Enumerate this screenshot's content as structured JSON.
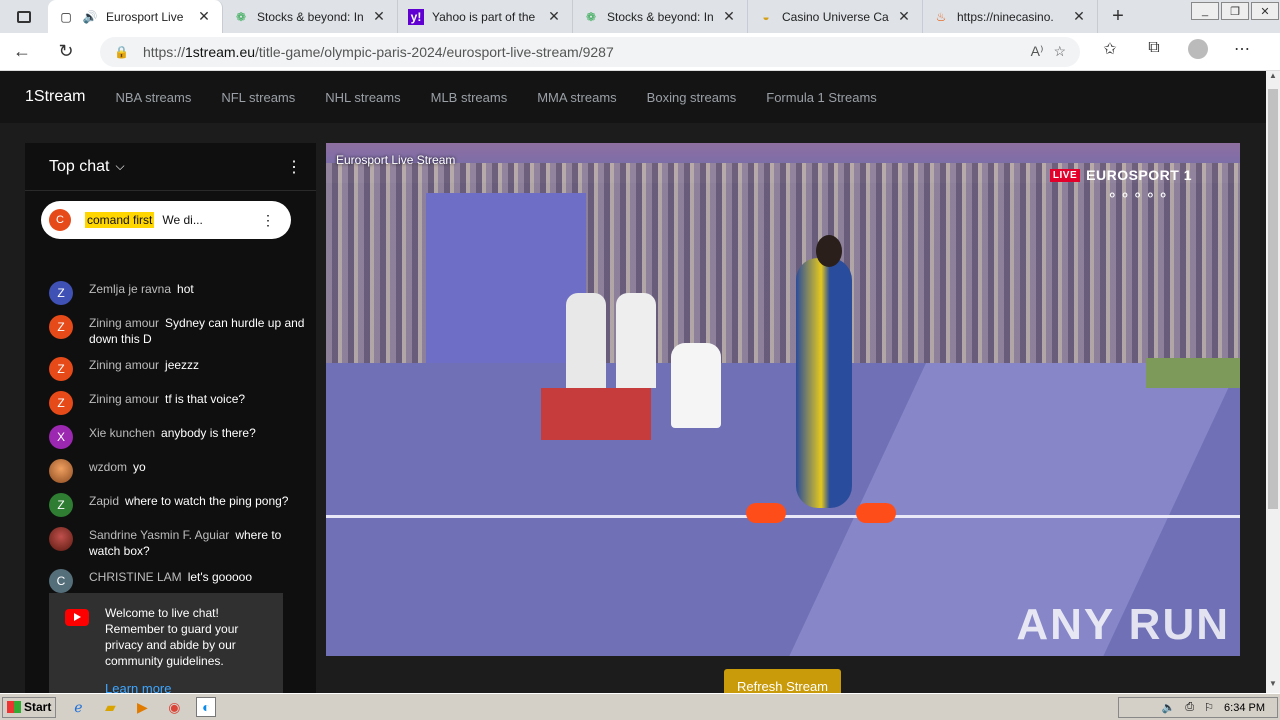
{
  "browser": {
    "tabs": [
      {
        "title": "Eurosport Live",
        "icon": "page-icon",
        "active": true
      },
      {
        "title": "Stocks & beyond: In",
        "icon": "stock-icon"
      },
      {
        "title": "Yahoo is part of the",
        "icon": "yahoo-icon"
      },
      {
        "title": "Stocks & beyond: In",
        "icon": "stock-icon"
      },
      {
        "title": "Casino Universe Ca",
        "icon": "casino-icon"
      },
      {
        "title": "https://ninecasino.",
        "icon": "flame-icon"
      }
    ],
    "url": {
      "prefix": "https://",
      "host": "1stream.eu",
      "path": "/title-game/olympic-paris-2024/eurosport-live-stream/9287"
    }
  },
  "site": {
    "brand": "1Stream",
    "nav": [
      "NBA streams",
      "NFL streams",
      "NHL streams",
      "MLB streams",
      "MMA streams",
      "Boxing streams",
      "Formula 1 Streams"
    ]
  },
  "chat": {
    "header": "Top chat",
    "pinned": {
      "avatar": "C",
      "author": "comand first",
      "text": "We di..."
    },
    "messages": [
      {
        "avatar": "Z",
        "color": "#3f51b5",
        "name": "Zemlja je ravna",
        "text": "hot"
      },
      {
        "avatar": "Z",
        "color": "#e64a19",
        "name": "Zining amour",
        "text": "Sydney can hurdle up and down this D"
      },
      {
        "avatar": "Z",
        "color": "#e64a19",
        "name": "Zining amour",
        "text": "jeezzz"
      },
      {
        "avatar": "Z",
        "color": "#e64a19",
        "name": "Zining amour",
        "text": "tf is that voice?"
      },
      {
        "avatar": "X",
        "color": "#9c27b0",
        "name": "Xie kunchen",
        "text": "anybody is there?"
      },
      {
        "avatar": "",
        "color": "#b5651d",
        "name": "wzdom",
        "text": "yo"
      },
      {
        "avatar": "Z",
        "color": "#2e7d32",
        "name": "Zapid",
        "text": "where to watch the ping pong?"
      },
      {
        "avatar": "",
        "color": "#8d3b2a",
        "name": "Sandrine Yasmin F. Aguiar",
        "text": "where to watch box?"
      },
      {
        "avatar": "C",
        "color": "#546e7a",
        "name": "CHRISTINE LAM",
        "text": "let's gooooo"
      }
    ],
    "welcome": {
      "text": "Welcome to live chat! Remember to guard your privacy and abide by our community guidelines.",
      "link": "Learn more"
    }
  },
  "video": {
    "title": "Eurosport Live Stream",
    "live_badge": "LIVE",
    "channel": "EUROSPORT 1",
    "watermark": "ANY RUN"
  },
  "refresh_button": "Refresh Stream",
  "taskbar": {
    "start": "Start",
    "time": "6:34 PM"
  }
}
